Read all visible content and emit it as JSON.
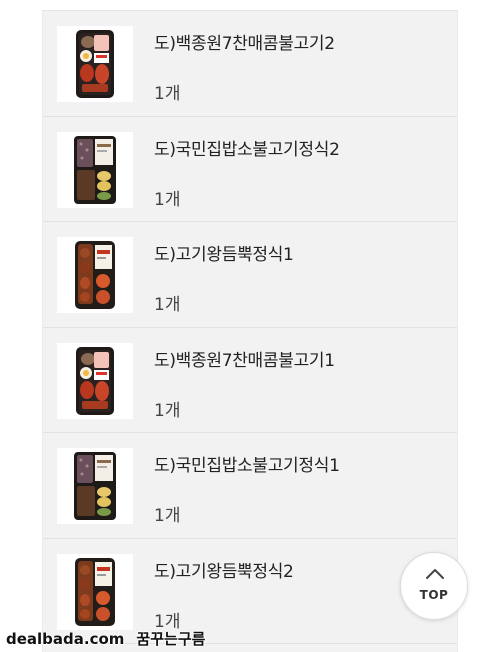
{
  "items": [
    {
      "name": "도)백종원7찬매콤불고기2",
      "qty": "1개",
      "image_type": "spicy-bulgogi-lunchbox"
    },
    {
      "name": "도)국민집밥소불고기정식2",
      "qty": "1개",
      "image_type": "beef-bulgogi-lunchbox"
    },
    {
      "name": "도)고기왕듬뿍정식1",
      "qty": "1개",
      "image_type": "meat-king-lunchbox"
    },
    {
      "name": "도)백종원7찬매콤불고기1",
      "qty": "1개",
      "image_type": "spicy-bulgogi-lunchbox"
    },
    {
      "name": "도)국민집밥소불고기정식1",
      "qty": "1개",
      "image_type": "beef-bulgogi-lunchbox"
    },
    {
      "name": "도)고기왕듬뿍정식2",
      "qty": "1개",
      "image_type": "meat-king-lunchbox"
    }
  ],
  "top_button": {
    "label": "TOP",
    "icon": "chevron-up-icon"
  },
  "watermark": {
    "site": "dealbada.com",
    "tag": "꿈꾸는구름"
  }
}
